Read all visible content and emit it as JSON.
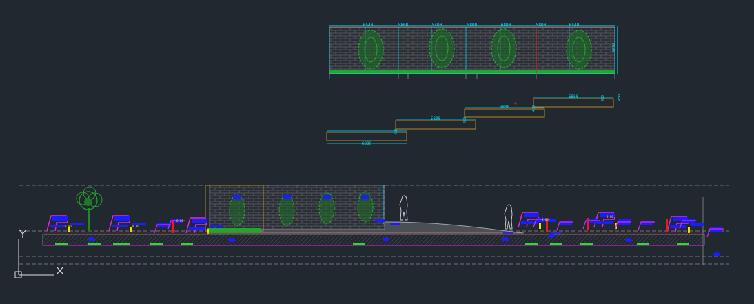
{
  "app": {
    "name": "CAD drawing viewport"
  },
  "colors": {
    "background": "#212830",
    "dim": "#00e5ff",
    "brick": "#5f6066",
    "hedge": "#23a52f",
    "blue": "#1a1dff",
    "magenta": "#e026e6",
    "red": "#e02020",
    "yellow": "#f0e000",
    "green_bar": "#22e02a",
    "orange": "#b8862a",
    "grey_line": "#8a8d92",
    "white": "#e0e0e0"
  },
  "ucs": {
    "y_label": "Y",
    "x_label": "X"
  },
  "top_elevation": {
    "dims_top": [
      "6540",
      "5800",
      "5400",
      "5800",
      "6800",
      "5800",
      "6540"
    ],
    "dim_side": "6058"
  },
  "stairs": {
    "dims": [
      "6800",
      "5800",
      "6800",
      "6800"
    ],
    "risers": [
      "450",
      "450",
      "450",
      "450"
    ],
    "side": "450"
  },
  "section": {
    "label_tags": [
      "8.00",
      "8.00",
      "8.00",
      "8.00",
      "8.00"
    ]
  }
}
